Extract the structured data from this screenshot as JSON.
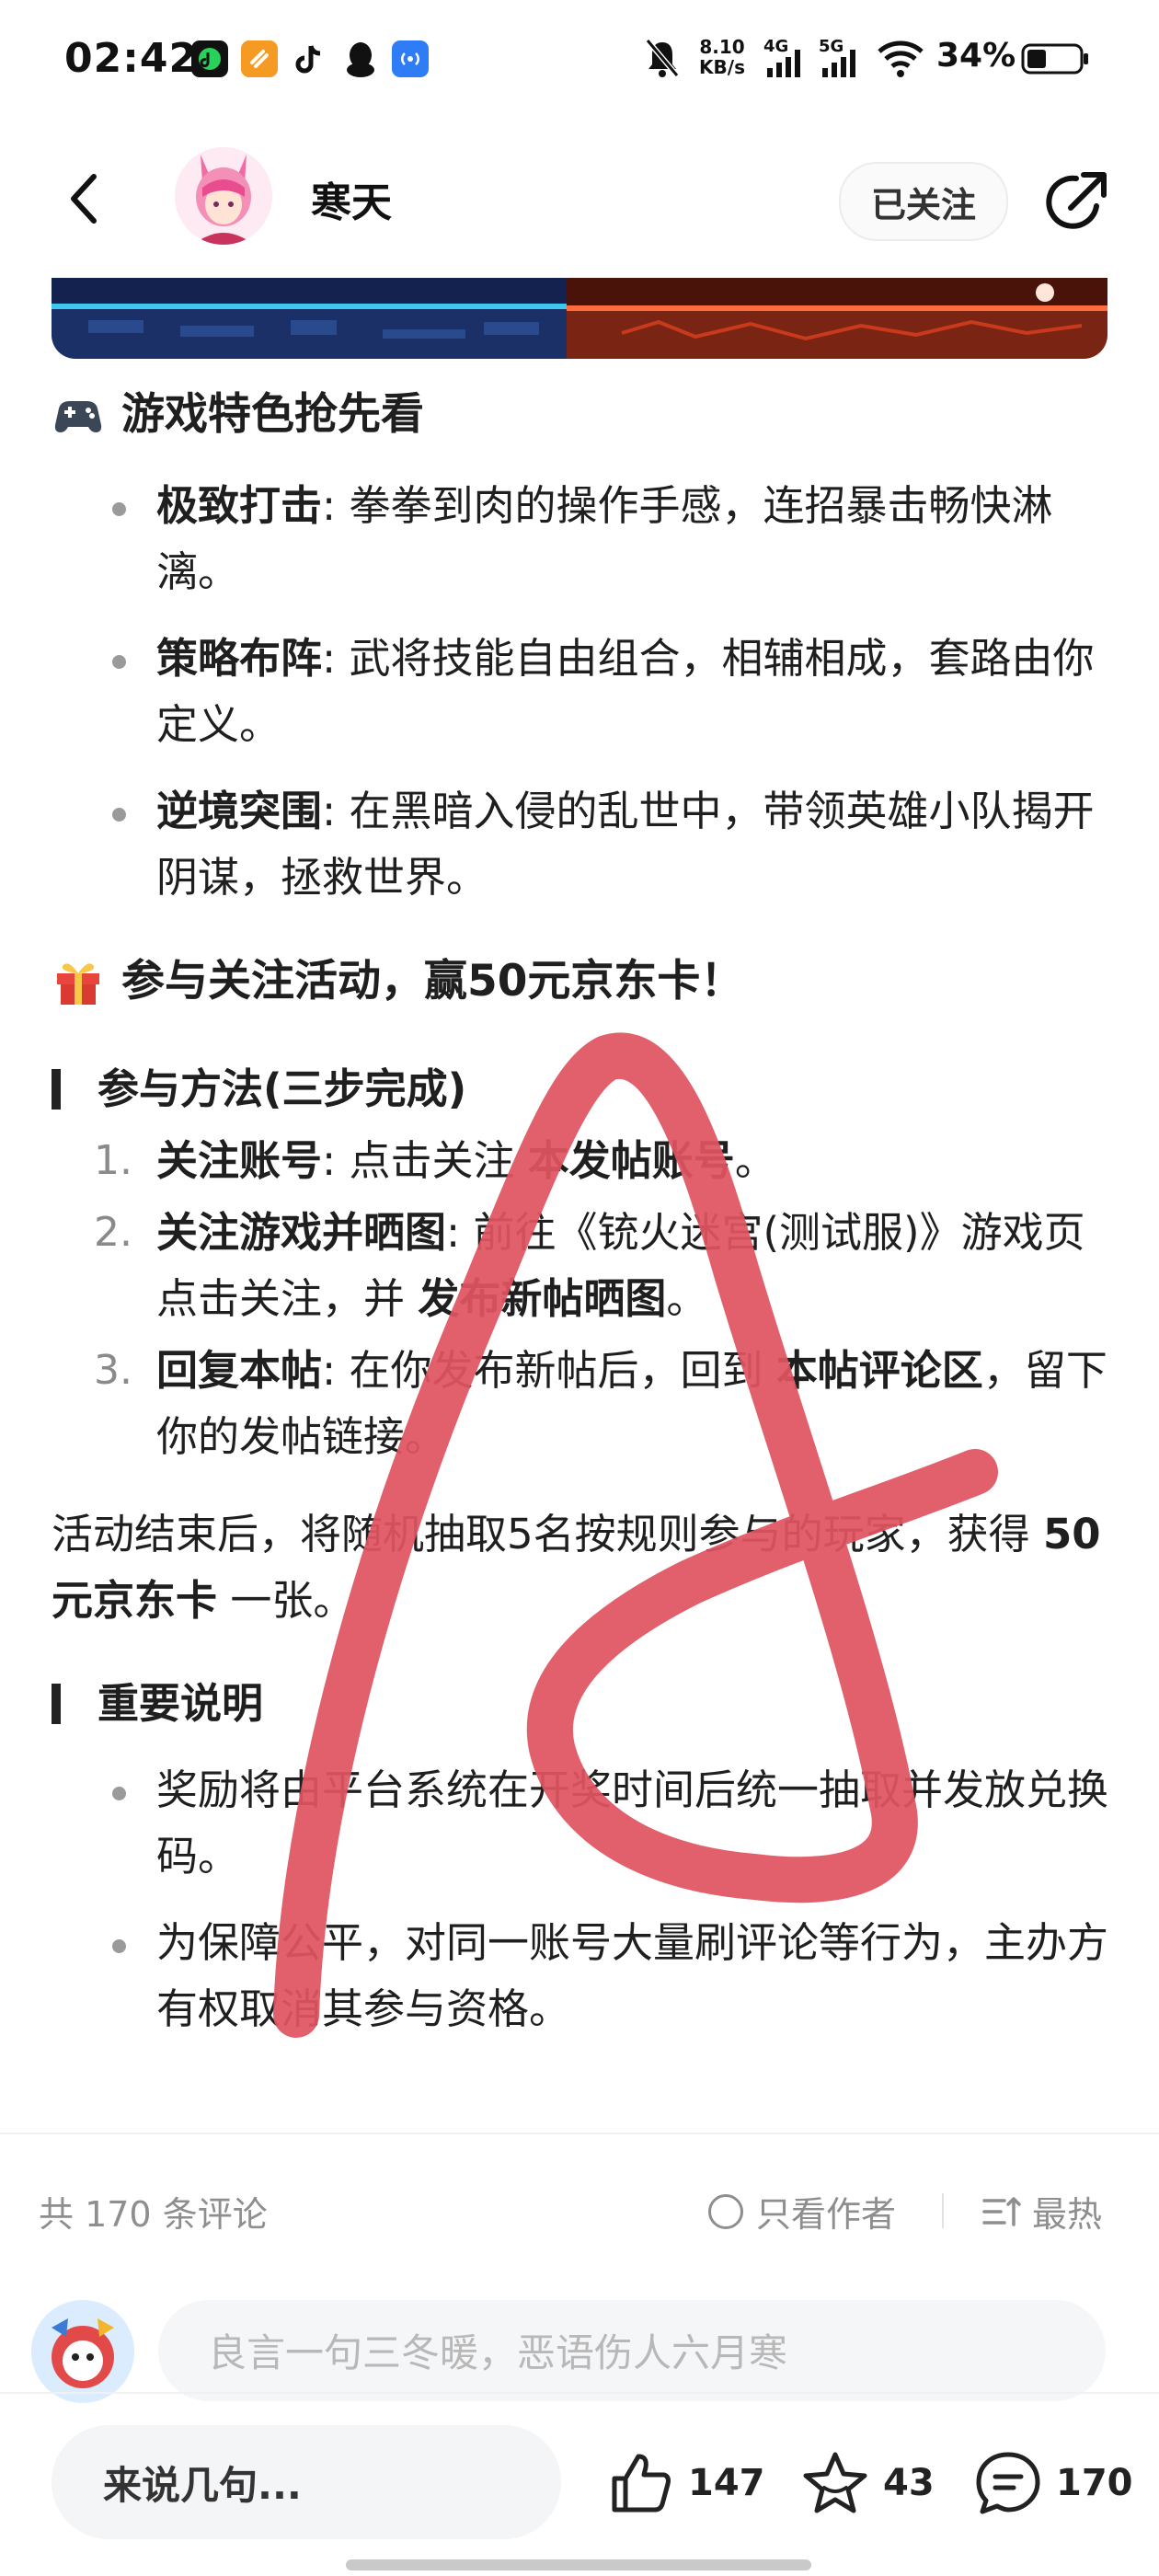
{
  "status_bar": {
    "time": "02:42",
    "net_speed_value": "8.10",
    "net_speed_unit": "KB/s",
    "signal_4g": "4G",
    "signal_5g": "5G",
    "battery": "34%",
    "icons": [
      "music-app-icon",
      "stripe-app-icon",
      "tiktok-icon",
      "qq-penguin-icon",
      "radio-app-icon",
      "mute-bell-icon",
      "wifi-icon",
      "battery-icon"
    ]
  },
  "header": {
    "author_name": "寒天",
    "follow_label": "已关注"
  },
  "content": {
    "features_title": "游戏特色抢先看",
    "features": [
      {
        "title": "极致打击",
        "text": ": 拳拳到肉的操作手感，连招暴击畅快淋漓。"
      },
      {
        "title": "策略布阵",
        "text": ": 武将技能自由组合，相辅相成，套路由你定义。"
      },
      {
        "title": "逆境突围",
        "text": ": 在黑暗入侵的乱世中，带领英雄小队揭开阴谋，拯救世界。"
      }
    ],
    "event_title": "参与关注活动，赢50元京东卡！",
    "method_title": "参与方法(三步完成)",
    "steps": [
      {
        "num": "1.",
        "bold": "关注账号",
        "text_before": ": 点击关注 ",
        "bold2": "本发帖账号",
        "text_after": "。"
      },
      {
        "num": "2.",
        "bold": "关注游戏并晒图",
        "text_before": ": 前往《铳火迷宫(测试服)》游戏页点击关注，并 ",
        "bold2": "发布新帖晒图",
        "text_after": "。"
      },
      {
        "num": "3.",
        "bold": "回复本帖",
        "text_before": ": 在你发布新帖后，回到 ",
        "bold2": "本帖评论区",
        "text_after": "，留下你的发帖链接。"
      }
    ],
    "summary_before": "活动结束后，将随机抽取5名按规则参与的玩家，获得 ",
    "summary_bold": "50元京东卡",
    "summary_after": " 一张。",
    "notes_title": "重要说明",
    "notes": [
      "奖励将由平台系统在开奖时间后统一抽取并发放兑换码。",
      "为保障公平，对同一账号大量刷评论等行为，主办方有权取消其参与资格。"
    ]
  },
  "comments": {
    "count_label": "共 170 条评论",
    "author_only_label": "只看作者",
    "sort_label": "最热",
    "input_placeholder": "良言一句三冬暖，恶语伤人六月寒"
  },
  "bottom_bar": {
    "say_placeholder": "来说几句...",
    "likes": "147",
    "favorites": "43",
    "comments": "170"
  },
  "colors": {
    "annotation_stroke": "#df5460",
    "banner_left": "#1d3a78",
    "banner_right": "#8a2a18"
  }
}
